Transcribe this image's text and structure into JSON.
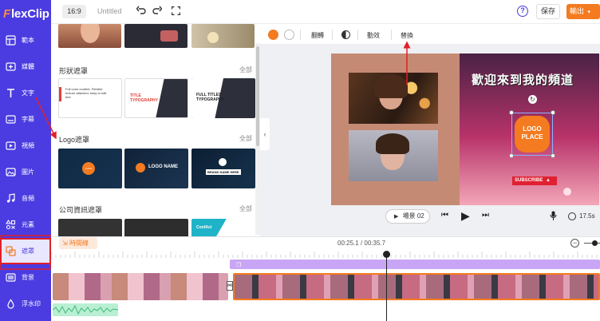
{
  "app": {
    "brand_prefix": "F",
    "brand_rest": "lexClip",
    "ratio": "16:9",
    "title": "Untitled",
    "save_label": "保存",
    "export_label": "輸出",
    "help_label": "?"
  },
  "sidebar": {
    "items": [
      {
        "label": "範本",
        "icon": "template-icon"
      },
      {
        "label": "媒體",
        "icon": "media-icon"
      },
      {
        "label": "文字",
        "icon": "text-icon"
      },
      {
        "label": "字幕",
        "icon": "subtitle-icon"
      },
      {
        "label": "視頻",
        "icon": "video-icon"
      },
      {
        "label": "圖片",
        "icon": "image-icon"
      },
      {
        "label": "音頻",
        "icon": "audio-icon"
      },
      {
        "label": "元素",
        "icon": "elements-icon"
      },
      {
        "label": "遮罩",
        "icon": "overlay-icon",
        "active": true
      },
      {
        "label": "背景",
        "icon": "background-icon"
      },
      {
        "label": "浮水印",
        "icon": "watermark-icon"
      }
    ]
  },
  "library": {
    "sections": [
      {
        "title": "形狀遮罩",
        "all": "全部"
      },
      {
        "title": "Logo遮罩",
        "all": "全部"
      },
      {
        "title": "公司資訊遮罩",
        "all": "全部"
      }
    ],
    "shape_thumbs": [
      {
        "text": "Full color content. Flexible texture attached, easy to edit text"
      },
      {
        "text": "TITLE TYPOGRAPHY"
      },
      {
        "text": "FULL TITLES TYPOGRAPHY"
      }
    ],
    "logo_thumbs": [
      {
        "text": "LOGO"
      },
      {
        "text": "LOGO NAME"
      },
      {
        "text": "BRAND NAME HERE"
      }
    ],
    "company_thumbs": [
      {
        "text": ""
      },
      {
        "text": ""
      },
      {
        "text": "ConfAct"
      }
    ]
  },
  "editor_toolbar": {
    "flip_label": "翻轉",
    "animation_label": "動效",
    "replace_label": "替換",
    "color1": "#f47b20",
    "color2": "#ffffff"
  },
  "canvas": {
    "headline": "歡迎來到我的頻道",
    "logo_text_1": "LOGO",
    "logo_text_2": "PLACE",
    "subscribe_label": "SUBSCRIBE"
  },
  "player": {
    "scene_label": "場景 02",
    "duration": "17.5"
  },
  "timeline": {
    "button_label": "時間線",
    "time_current": "00:25.1",
    "time_total": "00:35.7"
  },
  "colors": {
    "brand": "#4a3ce0",
    "accent": "#f47b20",
    "annotation": "#e0202a"
  }
}
